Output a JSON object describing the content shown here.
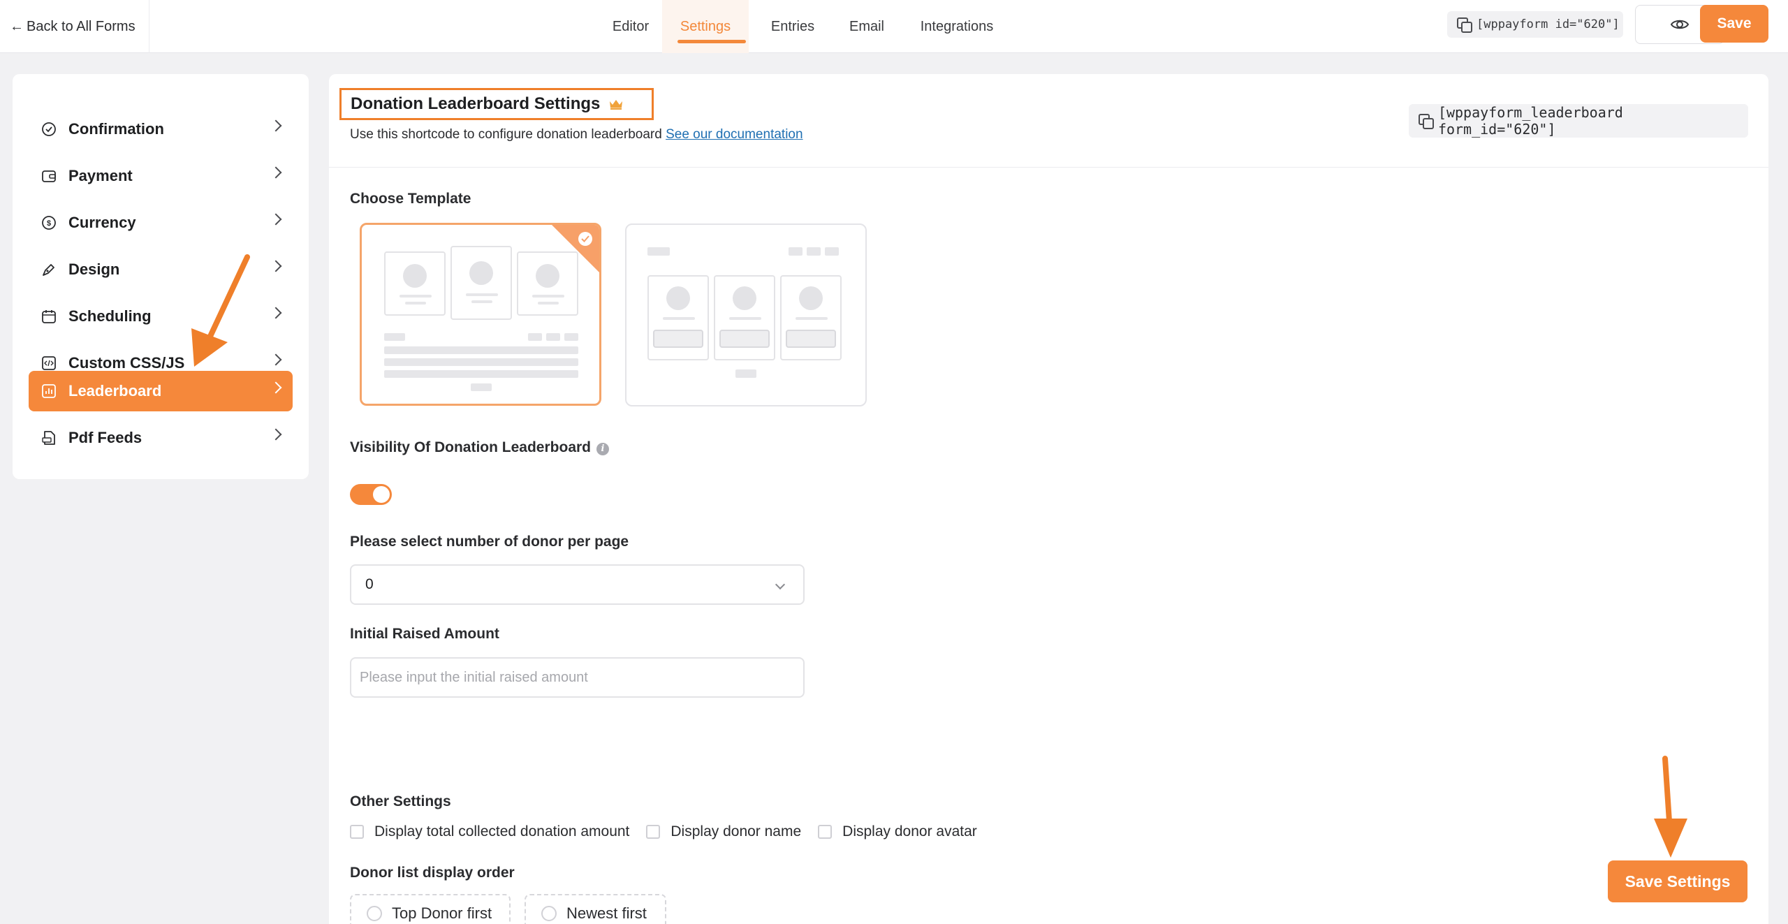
{
  "topbar": {
    "back_label": "Back to All Forms",
    "tabs": [
      {
        "label": "Editor"
      },
      {
        "label": "Settings"
      },
      {
        "label": "Entries"
      },
      {
        "label": "Email"
      },
      {
        "label": "Integrations"
      }
    ],
    "shortcode": "[wppayform id=\"620\"]",
    "save_label": "Save"
  },
  "sidebar": {
    "items": [
      {
        "label": "Confirmation",
        "icon": "check-circle-icon"
      },
      {
        "label": "Payment",
        "icon": "wallet-icon"
      },
      {
        "label": "Currency",
        "icon": "dollar-circle-icon"
      },
      {
        "label": "Design",
        "icon": "pen-icon"
      },
      {
        "label": "Scheduling",
        "icon": "calendar-icon"
      },
      {
        "label": "Custom CSS/JS",
        "icon": "code-icon"
      },
      {
        "label": "Leaderboard",
        "icon": "chart-icon"
      },
      {
        "label": "Pdf Feeds",
        "icon": "pdf-icon"
      }
    ],
    "active": "Leaderboard"
  },
  "main": {
    "title": "Donation Leaderboard Settings",
    "subtitle": "Use this shortcode to configure donation leaderboard",
    "doc_link": "See our documentation",
    "shortcode": "[wppayform_leaderboard form_id=\"620\"]",
    "choose_template_label": "Choose Template",
    "visibility_label": "Visibility Of Donation Leaderboard",
    "visibility_enabled": true,
    "donor_per_page_label": "Please select number of donor per page",
    "donor_per_page_value": "0",
    "initial_raised_label": "Initial Raised Amount",
    "initial_raised_placeholder": "Please input the initial raised amount",
    "other_settings_label": "Other Settings",
    "other_settings": [
      {
        "label": "Display total collected donation amount",
        "checked": false
      },
      {
        "label": "Display donor name",
        "checked": false
      },
      {
        "label": "Display donor avatar",
        "checked": false
      }
    ],
    "order_label": "Donor list display order",
    "order_options": [
      {
        "label": "Top Donor first"
      },
      {
        "label": "Newest first"
      }
    ],
    "save_settings_label": "Save Settings"
  },
  "colors": {
    "accent": "#f5883b",
    "annotation": "#ef7f2a"
  }
}
